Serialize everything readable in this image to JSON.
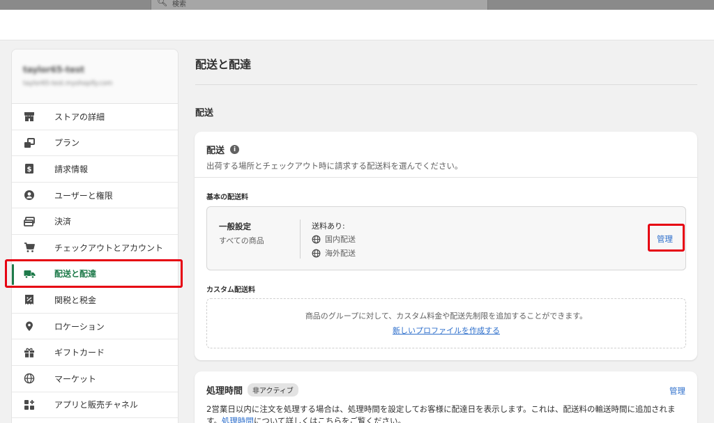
{
  "topbar": {
    "search_placeholder": "検索"
  },
  "sidebar": {
    "store_name": "taylor65-test",
    "store_url": "taylor65-test.myshopify.com",
    "items": [
      {
        "label": "ストアの詳細",
        "icon": "store-icon"
      },
      {
        "label": "プラン",
        "icon": "plan-icon"
      },
      {
        "label": "請求情報",
        "icon": "billing-icon"
      },
      {
        "label": "ユーザーと権限",
        "icon": "user-icon"
      },
      {
        "label": "決済",
        "icon": "payment-icon"
      },
      {
        "label": "チェックアウトとアカウント",
        "icon": "cart-icon"
      },
      {
        "label": "配送と配達",
        "icon": "truck-icon",
        "active": true
      },
      {
        "label": "関税と税金",
        "icon": "tax-icon"
      },
      {
        "label": "ロケーション",
        "icon": "location-icon"
      },
      {
        "label": "ギフトカード",
        "icon": "gift-icon"
      },
      {
        "label": "マーケット",
        "icon": "globe-icon"
      },
      {
        "label": "アプリと販売チャネル",
        "icon": "apps-icon"
      }
    ]
  },
  "main": {
    "page_title": "配送と配達",
    "section_title": "配送",
    "shipping_card": {
      "title": "配送",
      "description": "出荷する場所とチェックアウト時に請求する配送料を選んでください。",
      "base_rates_label": "基本の配送料",
      "general": {
        "title": "一般設定",
        "subtitle": "すべての商品",
        "rates_title": "送料あり:",
        "zones": [
          "国内配送",
          "海外配送"
        ],
        "manage_label": "管理"
      },
      "custom_rates_label": "カスタム配送料",
      "custom_text": "商品のグループに対して、カスタム料金や配送先制限を追加することができます。",
      "custom_link": "新しいプロファイルを作成する"
    },
    "processing_card": {
      "title": "処理時間",
      "badge": "非アクティブ",
      "manage_label": "管理",
      "desc_1": "2営業日以内に注文を処理する場合は、処理時間を設定してお客様に配達日を表示します。これは、配送料の輸送時間に追加されます。",
      "desc_link": "処理時間",
      "desc_2": "について詳しくはこちらをご覧ください。"
    }
  },
  "colors": {
    "accent_green": "#1e7a4a",
    "link_blue": "#2c6ecb",
    "highlight_red": "#e60012"
  }
}
